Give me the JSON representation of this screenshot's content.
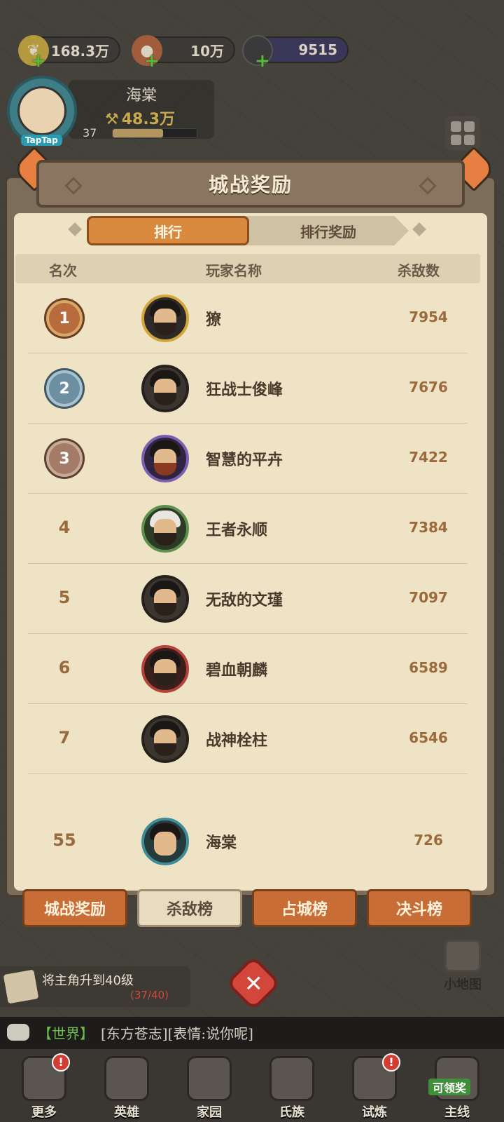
{
  "resources": {
    "gold": "168.3万",
    "meat": "10万",
    "gem": "9515"
  },
  "player": {
    "name": "海棠",
    "power": "48.3万",
    "level": "37",
    "avatar_tag": "TapTap",
    "exp_progress": 0.6
  },
  "panel": {
    "title": "城战奖励",
    "tabs": {
      "rank": "排行",
      "rank_reward": "排行奖励"
    },
    "columns": {
      "rank": "名次",
      "player": "玩家名称",
      "kills": "杀敌数"
    }
  },
  "rows": [
    {
      "rank": "1",
      "name": "獠",
      "kills": "7954",
      "avatar_style": "gold"
    },
    {
      "rank": "2",
      "name": "狂战士俊峰",
      "kills": "7676",
      "avatar_style": "dark"
    },
    {
      "rank": "3",
      "name": "智慧的平卉",
      "kills": "7422",
      "avatar_style": "purple"
    },
    {
      "rank": "4",
      "name": "王者永顺",
      "kills": "7384",
      "avatar_style": "green"
    },
    {
      "rank": "5",
      "name": "无敌的文瑾",
      "kills": "7097",
      "avatar_style": "dark"
    },
    {
      "rank": "6",
      "name": "碧血朝麟",
      "kills": "6589",
      "avatar_style": "red"
    },
    {
      "rank": "7",
      "name": "战神栓柱",
      "kills": "6546",
      "avatar_style": "dark"
    }
  ],
  "self_row": {
    "rank": "55",
    "name": "海棠",
    "kills": "726",
    "avatar_tag": "TapTap"
  },
  "bottom_tabs": [
    "城战奖励",
    "杀敌榜",
    "占城榜",
    "决斗榜"
  ],
  "task": {
    "text": "将主角升到40级",
    "progress": "(37/40)"
  },
  "minimap_label": "小地图",
  "chat": {
    "channel": "【世界】",
    "message": "[东方苍志][表情:说你呢]"
  },
  "nav": [
    {
      "label": "更多",
      "badge": "!"
    },
    {
      "label": "英雄",
      "badge": ""
    },
    {
      "label": "家园",
      "badge": ""
    },
    {
      "label": "氏族",
      "badge": ""
    },
    {
      "label": "试炼",
      "badge": "!"
    },
    {
      "label": "主线",
      "badge": "",
      "claim": "可领奖"
    }
  ],
  "colors": {
    "accent_orange": "#c86d35",
    "panel_bg": "#efe3c6",
    "kills_color": "#9b6a3c",
    "chat_channel": "#6bbd47",
    "badge_red": "#d13d32"
  },
  "icons": {
    "gold": "gold-leaf-icon",
    "meat": "meat-icon",
    "gem": "gem-icon",
    "close": "close-icon",
    "minimap": "map-icon",
    "chat": "chat-bubble-icon"
  }
}
